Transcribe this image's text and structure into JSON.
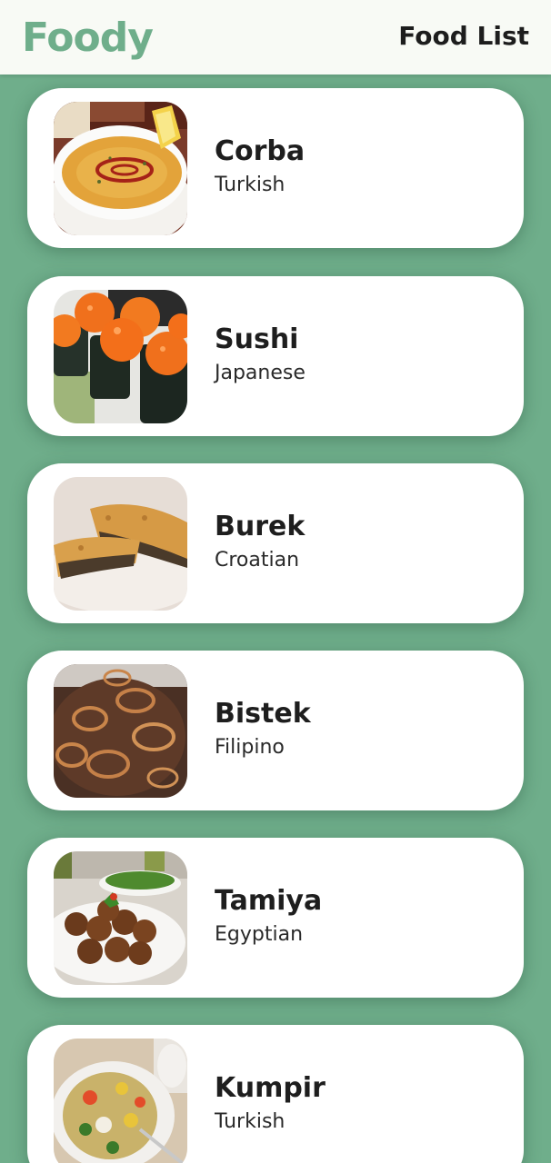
{
  "appbar": {
    "brand": "Foody",
    "title": "Food List"
  },
  "colors": {
    "brand_green": "#6fae8b",
    "appbar_bg": "#f8faf5",
    "card_bg": "#ffffff"
  },
  "meals": [
    {
      "name": "Corba",
      "area": "Turkish",
      "image": "lentil-soup-image"
    },
    {
      "name": "Sushi",
      "area": "Japanese",
      "image": "sushi-rolls-image"
    },
    {
      "name": "Burek",
      "area": "Croatian",
      "image": "burek-pastry-image"
    },
    {
      "name": "Bistek",
      "area": "Filipino",
      "image": "beef-onion-image"
    },
    {
      "name": "Tamiya",
      "area": "Egyptian",
      "image": "falafel-plate-image"
    },
    {
      "name": "Kumpir",
      "area": "Turkish",
      "image": "stuffed-potato-image"
    }
  ]
}
